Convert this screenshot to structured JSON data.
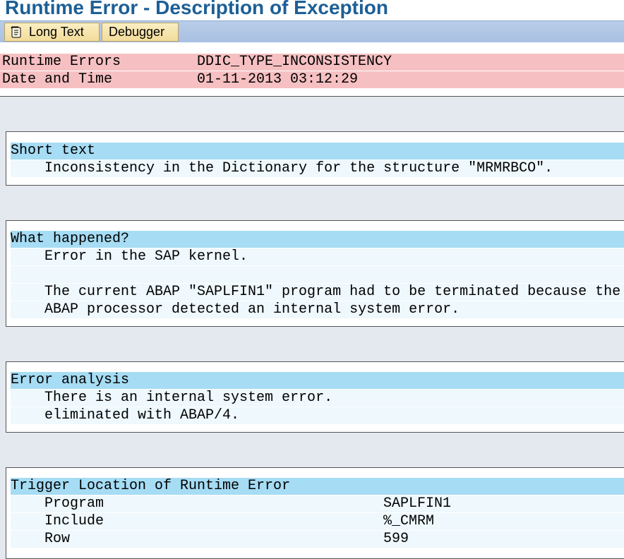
{
  "title": "Runtime Error - Description of Exception",
  "toolbar": {
    "long_text": "Long Text",
    "debugger": "Debugger"
  },
  "header": {
    "rows": [
      {
        "key": "Runtime Errors",
        "value": "DDIC_TYPE_INCONSISTENCY"
      },
      {
        "key": "Date and Time",
        "value": "01-11-2013 03:12:29"
      }
    ]
  },
  "sections": {
    "short_text": {
      "heading": "Short text",
      "lines": [
        "Inconsistency in the Dictionary for the structure \"MRMRBCO\"."
      ]
    },
    "what_happened": {
      "heading": "What happened?",
      "lines": [
        "Error in the SAP kernel.",
        "",
        "The current ABAP \"SAPLFIN1\" program had to be terminated because the",
        "ABAP processor detected an internal system error."
      ]
    },
    "error_analysis": {
      "heading": "Error analysis",
      "lines": [
        "There is an internal system error.",
        "eliminated with ABAP/4."
      ]
    },
    "trigger_location": {
      "heading": "Trigger Location of Runtime Error",
      "rows": [
        {
          "label": "Program",
          "value": "SAPLFIN1"
        },
        {
          "label": "Include",
          "value": "%_CMRM"
        },
        {
          "label": "Row",
          "value": "599"
        }
      ]
    }
  },
  "colors": {
    "title": "#1d5f96",
    "header_row": "#f6c0c2",
    "section_heading": "#a6dcf4",
    "section_line": "#eef8fd",
    "background": "#e4e8ef"
  }
}
